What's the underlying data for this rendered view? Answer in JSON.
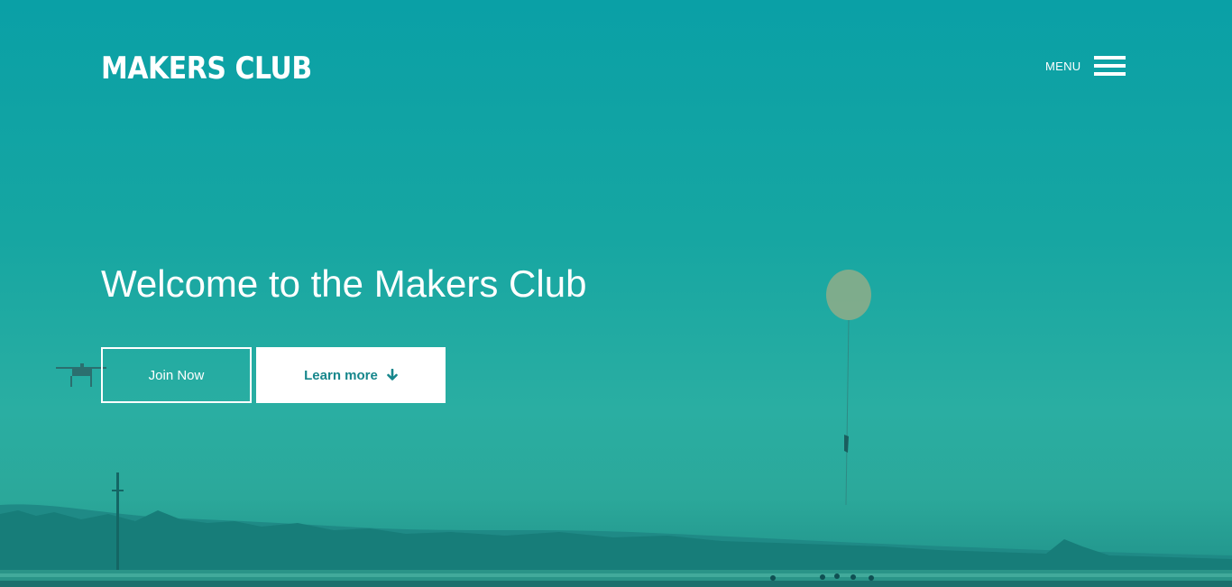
{
  "header": {
    "brand": "MAKERS CLUB",
    "menu_label": "MENU"
  },
  "hero": {
    "headline": "Welcome to the Makers Club",
    "join_label": "Join Now",
    "learn_label": "Learn more"
  },
  "colors": {
    "sky_top": "#0aa0a6",
    "sky_bottom": "#2ba89a",
    "accent_text": "#17878c",
    "white": "#ffffff"
  },
  "icons": {
    "menu": "hamburger-icon",
    "learn_more": "arrow-down-icon"
  }
}
